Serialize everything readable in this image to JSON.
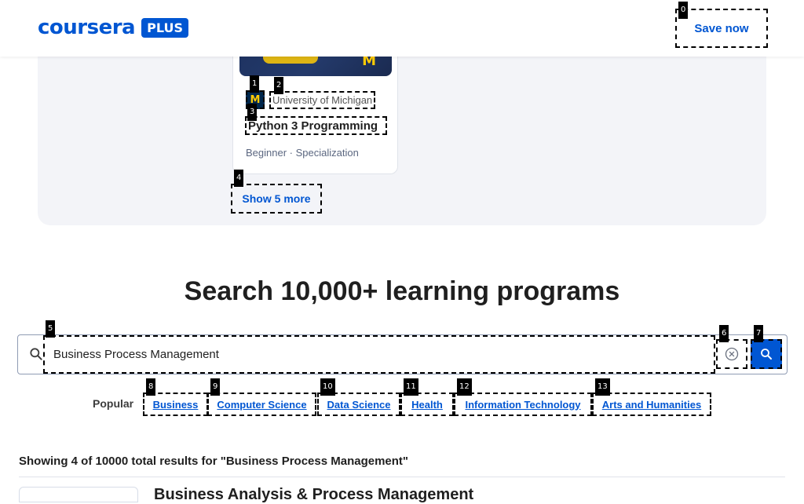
{
  "header": {
    "logo_word": "coursera",
    "logo_plus": "PLUS",
    "save_label": "Save now"
  },
  "markers": [
    "0",
    "1",
    "2",
    "3",
    "4",
    "5",
    "6",
    "7",
    "8",
    "9",
    "10",
    "11",
    "12",
    "13"
  ],
  "featured": {
    "university": "University of Michigan",
    "university_logo_letter": "M",
    "title": "Python 3 Programming",
    "meta": "Beginner · Specialization",
    "show_more": "Show 5 more"
  },
  "search": {
    "heading": "Search 10,000+ learning programs",
    "query": "Business Process Management",
    "popular_label": "Popular",
    "chips": [
      "Business",
      "Computer Science",
      "Data Science",
      "Health",
      "Information Technology",
      "Arts and Humanities"
    ]
  },
  "results": {
    "summary": "Showing 4 of 10000 total results for \"Business Process Management\"",
    "first_title": "Business Analysis & Process Management"
  },
  "colors": {
    "brand": "#0056d2",
    "panel_bg": "#f3f4f8",
    "michigan_maize": "#ffcb05",
    "michigan_blue": "#00274c"
  }
}
